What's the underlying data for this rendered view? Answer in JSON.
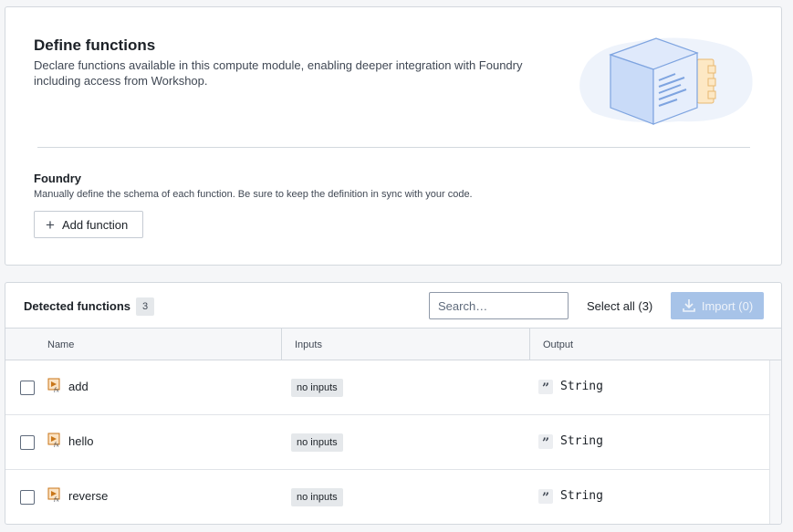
{
  "define": {
    "title": "Define functions",
    "description": "Declare functions available in this compute module, enabling deeper integration with Foundry including access from Workshop.",
    "foundry_title": "Foundry",
    "foundry_description": "Manually define the schema of each function. Be sure to keep the definition in sync with your code.",
    "add_function_label": "Add function"
  },
  "detected": {
    "title": "Detected functions",
    "count": "3",
    "search_placeholder": "Search…",
    "select_all_label": "Select all (3)",
    "import_label": "Import (0)",
    "columns": [
      "Name",
      "Inputs",
      "Output"
    ],
    "rows": [
      {
        "name": "add",
        "inputs": "no inputs",
        "output": "String",
        "icon": "function-icon",
        "output_icon": "quote-icon"
      },
      {
        "name": "hello",
        "inputs": "no inputs",
        "output": "String",
        "icon": "function-icon",
        "output_icon": "quote-icon"
      },
      {
        "name": "reverse",
        "inputs": "no inputs",
        "output": "String",
        "icon": "function-icon",
        "output_icon": "quote-icon"
      }
    ]
  },
  "colors": {
    "primary_disabled": "#a7c3e8",
    "border": "#d3d8de",
    "background": "#f5f6f8"
  }
}
